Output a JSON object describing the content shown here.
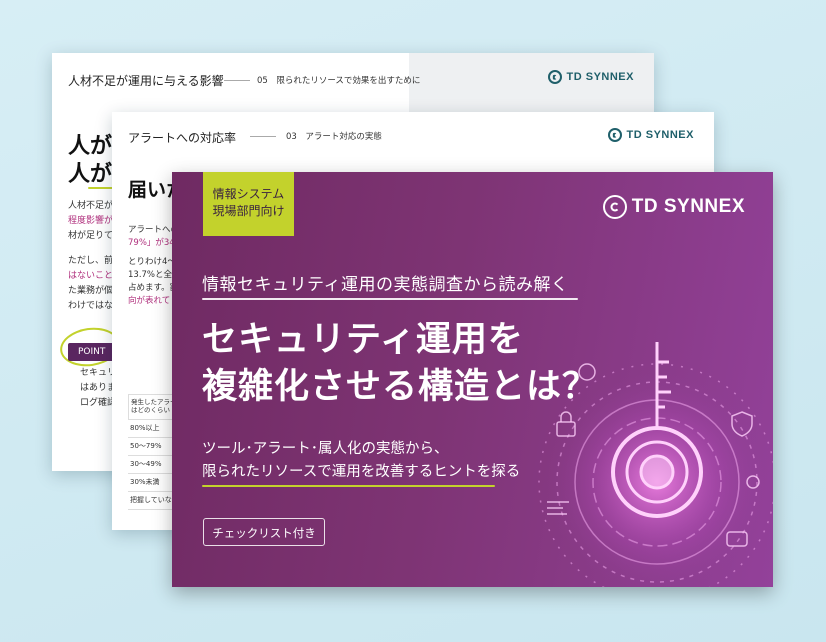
{
  "back_page": {
    "title": "人材不足が運用に与える影響",
    "section": "05　限られたリソースで効果を出すために",
    "logo": "TD SYNNEX",
    "heading_line1": "人が足",
    "heading_line2": "人がや",
    "body_lines": [
      "人材不足が",
      "程度影響が",
      "材が足りてい",
      "",
      "ただし、前へ",
      "はないことが",
      "た業務が個",
      "わけではない"
    ],
    "point_label": "POINT",
    "point_lines": [
      "セキュリ",
      "はありま",
      "ログ確認"
    ]
  },
  "mid_page": {
    "title": "アラートへの対応率",
    "section": "03　アラート対応の実態",
    "logo": "TD SYNNEX",
    "heading": "届いた",
    "body_lines": [
      "アラートへの",
      "79%」が34",
      "",
      "とりわけ4～",
      "13.7%と全",
      "占めます。割",
      "向が表れて"
    ],
    "table_header": "発生したアラートはどのくらい",
    "table_rows": [
      "80%以上",
      "50～79%",
      "30～49%",
      "30%未満",
      "把握していな"
    ]
  },
  "cover": {
    "tag_line1": "情報システム",
    "tag_line2": "現場部門向け",
    "logo": "TD SYNNEX",
    "subtitle": "情報セキュリティ運用の実態調査から読み解く",
    "title_line1": "セキュリティ運用を",
    "title_line2": "複雑化させる構造とは？",
    "desc_line1": "ツール･アラート･属人化の実態から、",
    "desc_line2": "限られたリソースで運用を改善するヒントを探る",
    "button": "チェックリスト付き"
  },
  "colors": {
    "background": "#d4ecf3",
    "cover_purple": "#7e3474",
    "accent_lime": "#c3d22c",
    "logo_teal": "#1f5f6a",
    "highlight_pink": "#b0307d"
  }
}
